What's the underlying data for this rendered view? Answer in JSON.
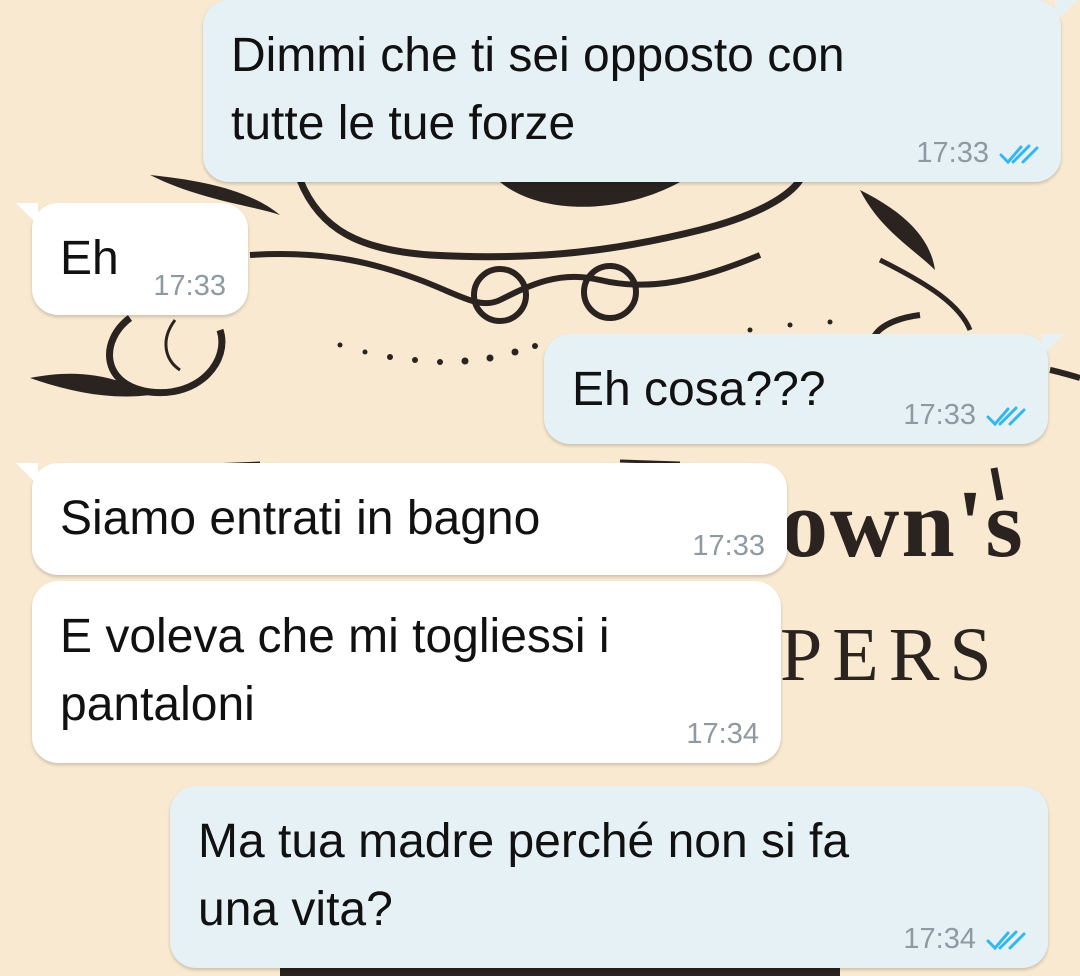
{
  "wallpaper": {
    "word_1": "own's",
    "word_2": "PERS"
  },
  "colors": {
    "background": "#f8e9d0",
    "outgoing_bubble": "#e6f1f6",
    "incoming_bubble": "#ffffff",
    "read_ticks": "#34b7f1",
    "timestamp": "#8e9aa2"
  },
  "messages": [
    {
      "direction": "outgoing",
      "text": "Dimmi che ti sei opposto con\ntutte le tue forze",
      "time": "17:33",
      "status": "read",
      "status_icon": "double-check-icon"
    },
    {
      "direction": "incoming",
      "text": "Eh",
      "time": "17:33"
    },
    {
      "direction": "outgoing",
      "text": "Eh cosa???",
      "time": "17:33",
      "status": "read",
      "status_icon": "double-check-icon"
    },
    {
      "direction": "incoming",
      "text": "Siamo entrati in bagno",
      "time": "17:33"
    },
    {
      "direction": "incoming",
      "text": "E voleva che mi togliessi i\npantaloni",
      "time": "17:34"
    },
    {
      "direction": "outgoing",
      "text": "Ma tua madre perché non si fa\nuna vita?",
      "time": "17:34",
      "status": "read",
      "status_icon": "double-check-icon"
    }
  ]
}
